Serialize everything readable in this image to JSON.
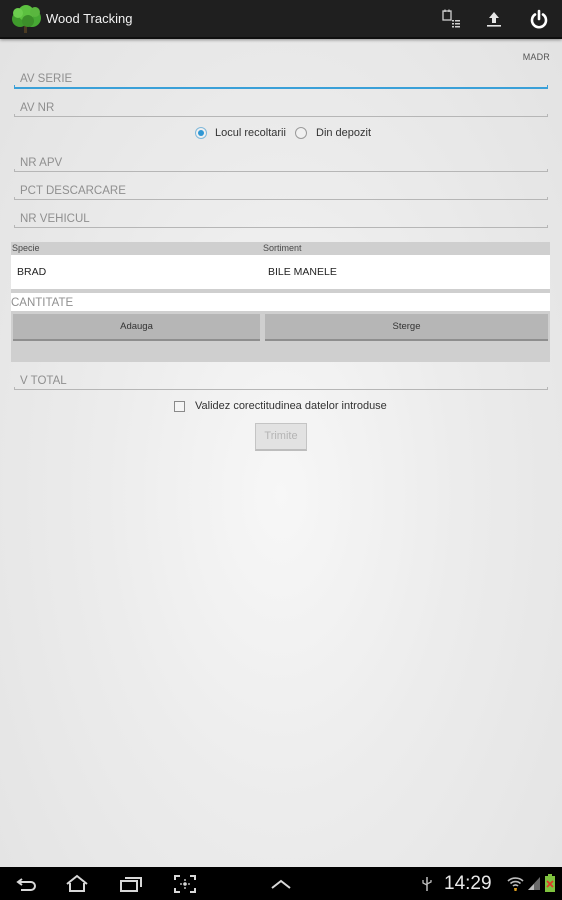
{
  "action_bar": {
    "title": "Wood Tracking",
    "icons": [
      "tree-logo-icon",
      "calendar-list-icon",
      "upload-icon",
      "power-icon"
    ]
  },
  "user_label": "MADR",
  "fields": {
    "av_serie": {
      "placeholder": "AV SERIE",
      "value": ""
    },
    "av_nr": {
      "placeholder": "AV NR",
      "value": ""
    },
    "nr_apv": {
      "placeholder": "NR APV",
      "value": ""
    },
    "pct_descarcare": {
      "placeholder": "PCT DESCARCARE",
      "value": ""
    },
    "nr_vehicul": {
      "placeholder": "NR VEHICUL",
      "value": ""
    },
    "v_total": {
      "placeholder": "V TOTAL",
      "value": ""
    }
  },
  "source_options": [
    {
      "label": "Locul recoltarii",
      "checked": true
    },
    {
      "label": "Din depozit",
      "checked": false
    }
  ],
  "table": {
    "headers": [
      "Specie",
      "Sortiment"
    ],
    "rows": [
      [
        "BRAD",
        "BILE MANELE"
      ]
    ]
  },
  "cantitate": {
    "placeholder": "CANTITATE",
    "value": ""
  },
  "buttons": {
    "add": "Adauga",
    "delete": "Sterge",
    "send": "Trimite"
  },
  "validation_checkbox": {
    "label": "Validez corectitudinea datelor introduse",
    "checked": false
  },
  "status_bar": {
    "time": "14:29",
    "nav_icons": [
      "back-icon",
      "home-icon",
      "recent-apps-icon",
      "screenshot-icon",
      "chevron-up-icon"
    ],
    "status_icons": [
      "usb-icon",
      "wifi-icon",
      "signal-icon",
      "battery-icon"
    ]
  },
  "colors": {
    "accent": "#2f97d4",
    "action_bar": "#1f1f1f",
    "panel": "#cfcfcf",
    "button": "#b6b6b6"
  }
}
